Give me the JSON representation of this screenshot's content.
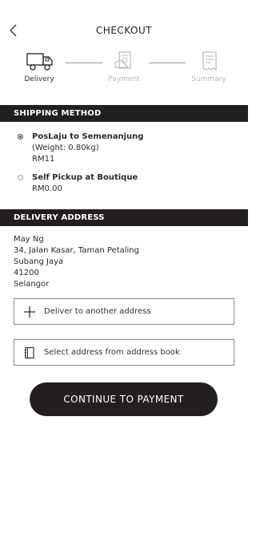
{
  "header": {
    "title": "CHECKOUT"
  },
  "steps": [
    {
      "label": "Delivery",
      "state": "active",
      "icon": "truck-icon"
    },
    {
      "label": "Payment",
      "state": "inactive",
      "icon": "cash-icon"
    },
    {
      "label": "Summary",
      "state": "inactive",
      "icon": "receipt-icon"
    }
  ],
  "shipping": {
    "heading": "SHIPPING METHOD",
    "options": [
      {
        "title": "PosLaju to Semenanjung",
        "detail": "(Weight: 0.80kg)",
        "price": "RM11",
        "selected": true
      },
      {
        "title": "Self Pickup at Boutique",
        "price": "RM0.00",
        "selected": false
      }
    ]
  },
  "delivery": {
    "heading": "DELIVERY ADDRESS",
    "address": {
      "name": "May Ng",
      "line1": "34, Jalan Kasar, Taman Petaling",
      "city": "Subang Jaya",
      "postcode": "41200",
      "state": "Selangor"
    },
    "another_label": "Deliver to another address",
    "addressbook_label": "Select address from address book"
  },
  "continue_label": "CONTINUE TO PAYMENT",
  "colors": {
    "dark": "#231f20",
    "inactive": "#b9b9b9"
  }
}
